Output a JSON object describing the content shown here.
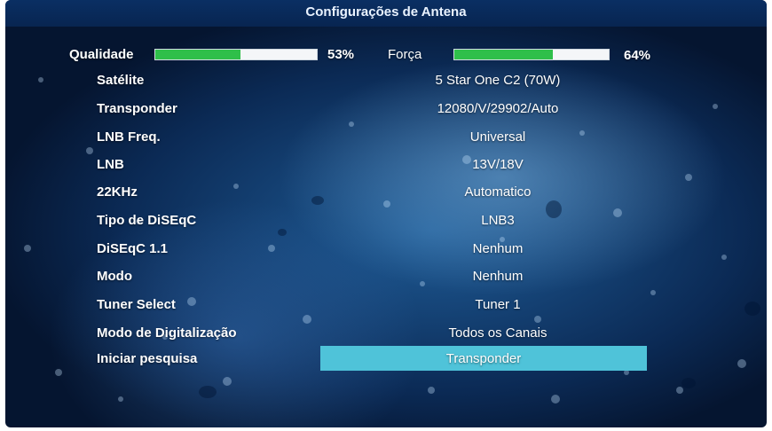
{
  "title": "Configurações de Antena",
  "signal": {
    "quality_label": "Qualidade",
    "quality_value": 53,
    "quality_text": "53%",
    "strength_label": "Força",
    "strength_value": 64,
    "strength_text": "64%"
  },
  "settings": [
    {
      "label": "Satélite",
      "value": "5 Star One C2  (70W)"
    },
    {
      "label": "Transponder",
      "value": "12080/V/29902/Auto"
    },
    {
      "label": "LNB Freq.",
      "value": "Universal"
    },
    {
      "label": "LNB",
      "value": "13V/18V"
    },
    {
      "label": "22KHz",
      "value": "Automatico"
    },
    {
      "label": "Tipo de DiSEqC",
      "value": "LNB3"
    },
    {
      "label": "DiSEqC 1.1",
      "value": "Nenhum"
    },
    {
      "label": "Modo",
      "value": "Nenhum"
    },
    {
      "label": "Tuner Select",
      "value": "Tuner 1"
    },
    {
      "label": "Modo de Digitalização",
      "value": "Todos os Canais"
    },
    {
      "label": "Iniciar pesquisa",
      "value": "Transponder"
    }
  ],
  "colors": {
    "bar_fill": "#2fbf4a",
    "highlight": "#4fc3d9",
    "background": "#0b2a55"
  }
}
